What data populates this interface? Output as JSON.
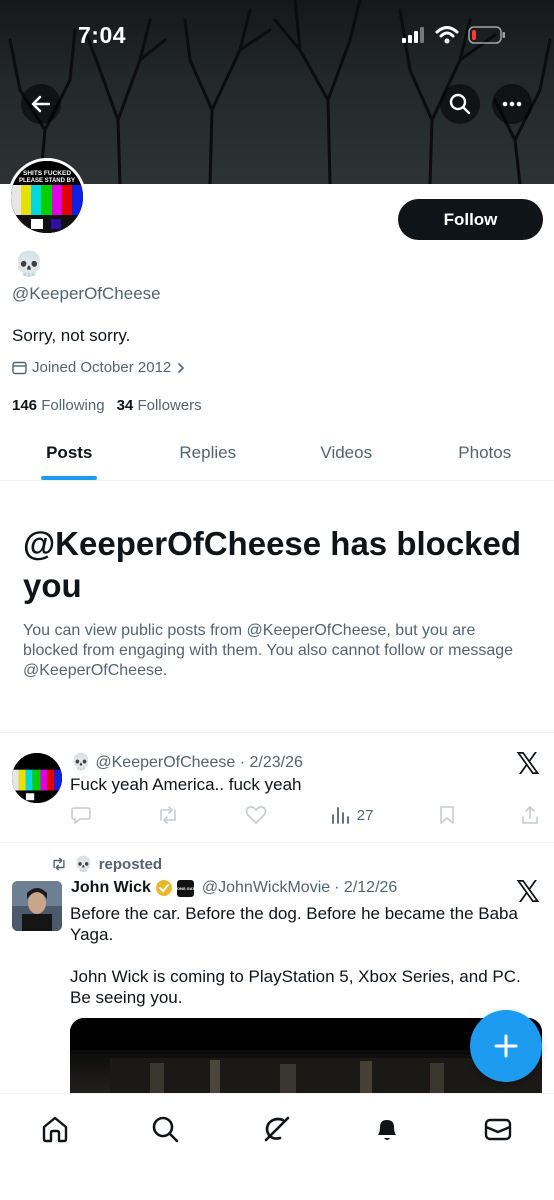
{
  "status_bar": {
    "time": "7:04"
  },
  "profile": {
    "avatar_text_line1": "SHITS FUCKED",
    "avatar_text_line2": "PLEASE STAND BY",
    "display_name_emoji": "💀",
    "handle": "@KeeperOfCheese",
    "bio": "Sorry, not sorry.",
    "joined": "Joined October 2012",
    "following_count": "146",
    "following_label": "Following",
    "followers_count": "34",
    "followers_label": "Followers",
    "follow_label": "Follow"
  },
  "tabs": [
    {
      "label": "Posts"
    },
    {
      "label": "Replies"
    },
    {
      "label": "Videos"
    },
    {
      "label": "Photos"
    }
  ],
  "blocked_notice": {
    "title": "@KeeperOfCheese has blocked you",
    "text": "You can view public posts from @KeeperOfCheese, but you are blocked from engaging with them. You also cannot follow or message @KeeperOfCheese."
  },
  "posts": [
    {
      "author_emoji": "💀",
      "handle": "@KeeperOfCheese",
      "date": "· 2/23/26",
      "text": "Fuck yeah America.. fuck yeah",
      "views": "27"
    },
    {
      "repost_label": "reposted",
      "repost_emoji": "💀",
      "author_name": "John Wick",
      "handle": "@JohnWickMovie",
      "date": "· 2/12/26",
      "badge_text": "LIONS GATE",
      "text_line1": "Before the car. Before the dog. Before he became the Baba Yaga.",
      "text_line2": "John Wick is coming to PlayStation 5, Xbox Series, and PC. Be seeing you."
    }
  ],
  "colors": {
    "accent": "#1d9bf0",
    "text": "#0f1419",
    "muted": "#536471",
    "verified_gold": "#e8b829"
  },
  "icons": [
    "back-arrow-icon",
    "search-icon",
    "more-icon",
    "calendar-icon",
    "chevron-right-icon",
    "x-logo-icon",
    "reply-icon",
    "repost-icon",
    "like-icon",
    "views-icon",
    "bookmark-icon",
    "share-icon",
    "plus-icon",
    "home-icon",
    "grok-icon",
    "bell-icon",
    "mail-icon"
  ]
}
